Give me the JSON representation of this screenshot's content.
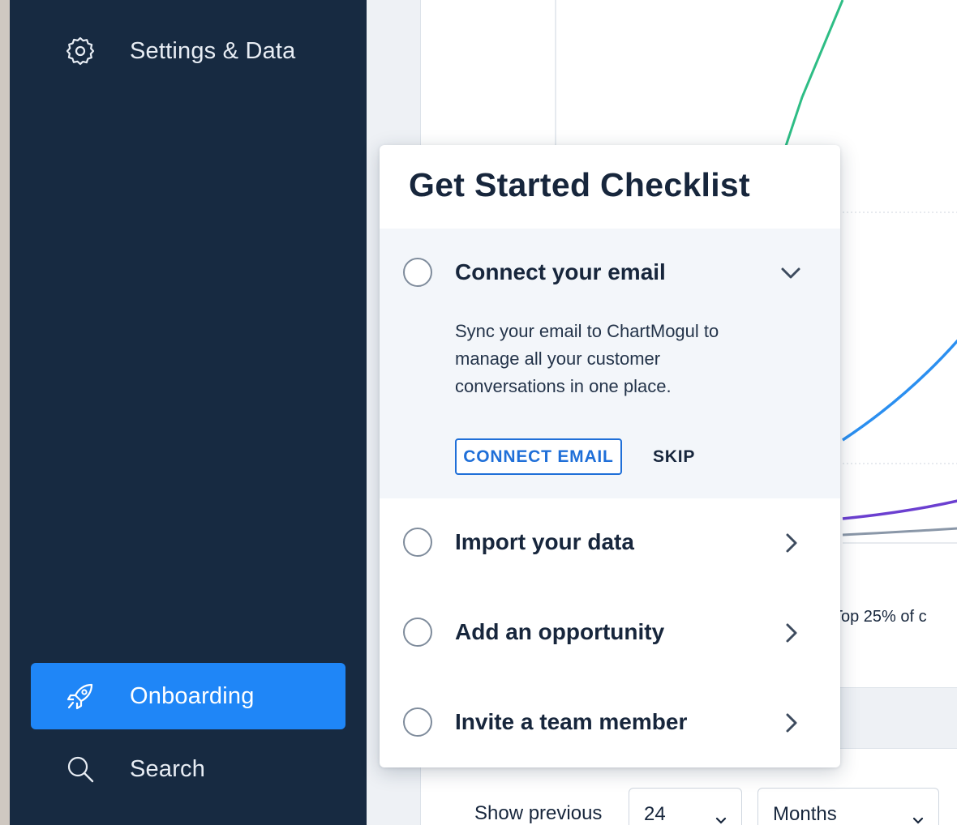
{
  "sidebar": {
    "settings_label": "Settings & Data",
    "onboarding_label": "Onboarding",
    "search_label": "Search",
    "active_color": "#1f86f7",
    "background": "#172a41"
  },
  "background": {
    "legend_label": "Top 25% of c",
    "show_previous_label": "Show previous",
    "count_value": "24",
    "unit_value": "Months"
  },
  "checklist": {
    "title": "Get Started Checklist",
    "items": [
      {
        "title": "Connect your email",
        "expanded": true,
        "icon": "chevron-down-icon",
        "description": "Sync your email to ChartMogul to manage all your customer conversations in one place.",
        "primary_action": "CONNECT EMAIL",
        "secondary_action": "SKIP"
      },
      {
        "title": "Import your data",
        "expanded": false,
        "icon": "chevron-right-icon"
      },
      {
        "title": "Add an opportunity",
        "expanded": false,
        "icon": "chevron-right-icon"
      },
      {
        "title": "Invite a team member",
        "expanded": false,
        "icon": "chevron-right-icon"
      }
    ]
  },
  "colors": {
    "series_green": "#2ebd85",
    "series_blue": "#2b8ff0",
    "series_purple": "#6b3fd0",
    "series_gray": "#8a97a8",
    "accent": "#1f6fd8"
  }
}
